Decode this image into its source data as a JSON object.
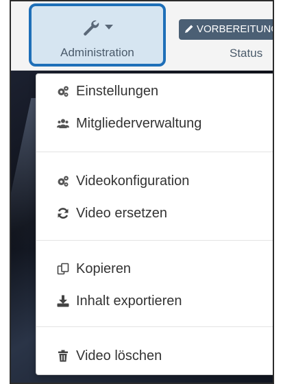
{
  "toolbar": {
    "administration_label": "Administration",
    "status_badge": "VORBEREITUNG",
    "status_label": "Status"
  },
  "menu": {
    "items": [
      {
        "label": "Einstellungen",
        "icon": "cogs-icon"
      },
      {
        "label": "Mitgliederverwaltung",
        "icon": "users-icon"
      },
      {
        "label": "Videokonfiguration",
        "icon": "cogs-icon"
      },
      {
        "label": "Video ersetzen",
        "icon": "refresh-icon"
      },
      {
        "label": "Kopieren",
        "icon": "copy-icon"
      },
      {
        "label": "Inhalt exportieren",
        "icon": "download-icon"
      },
      {
        "label": "Video löschen",
        "icon": "trash-icon"
      }
    ]
  },
  "colors": {
    "highlight_border": "#1e6fb8",
    "admin_button_bg": "#d6e5f1",
    "status_badge_bg": "#4b5f74",
    "menu_text": "#333333"
  }
}
